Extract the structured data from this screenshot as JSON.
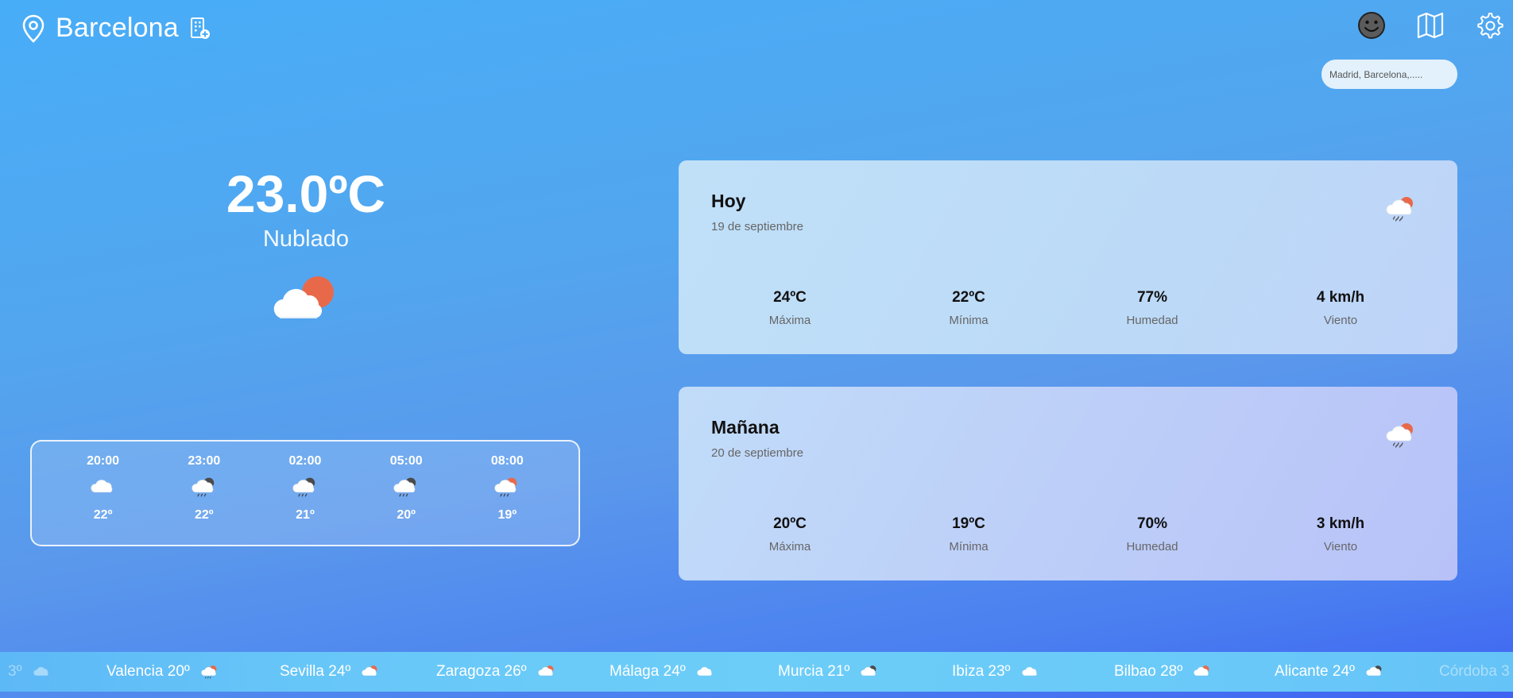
{
  "header": {
    "city": "Barcelona",
    "search_placeholder": "Madrid, Barcelona,....."
  },
  "current": {
    "temperature": "23.0ºC",
    "condition": "Nublado",
    "icon": "cloud-sun-icon"
  },
  "hourly": [
    {
      "time": "20:00",
      "temp": "22º",
      "icon": "cloud-icon"
    },
    {
      "time": "23:00",
      "temp": "22º",
      "icon": "cloud-moon-rain-icon"
    },
    {
      "time": "02:00",
      "temp": "21º",
      "icon": "cloud-moon-rain-icon"
    },
    {
      "time": "05:00",
      "temp": "20º",
      "icon": "cloud-moon-rain-icon"
    },
    {
      "time": "08:00",
      "temp": "19º",
      "icon": "cloud-sun-rain-icon"
    }
  ],
  "forecast": {
    "today": {
      "title": "Hoy",
      "date": "19 de septiembre",
      "icon": "cloud-sun-rain-icon",
      "max": "24ºC",
      "max_label": "Máxima",
      "min": "22ºC",
      "min_label": "Mínima",
      "humidity": "77%",
      "humidity_label": "Humedad",
      "wind": "4 km/h",
      "wind_label": "Viento"
    },
    "tomorrow": {
      "title": "Mañana",
      "date": "20 de septiembre",
      "icon": "cloud-sun-rain-icon",
      "max": "20ºC",
      "max_label": "Máxima",
      "min": "19ºC",
      "min_label": "Mínima",
      "humidity": "70%",
      "humidity_label": "Humedad",
      "wind": "3 km/h",
      "wind_label": "Viento"
    }
  },
  "ticker": [
    {
      "text": "3º",
      "icon": "cloud-icon"
    },
    {
      "text": "Valencia 20º",
      "icon": "cloud-sun-rain-icon"
    },
    {
      "text": "Sevilla 24º",
      "icon": "cloud-sun-icon"
    },
    {
      "text": "Zaragoza 26º",
      "icon": "cloud-sun-icon"
    },
    {
      "text": "Málaga 24º",
      "icon": "cloud-icon"
    },
    {
      "text": "Murcia 21º",
      "icon": "cloud-moon-icon"
    },
    {
      "text": "Ibiza 23º",
      "icon": "cloud-icon"
    },
    {
      "text": "Bilbao 28º",
      "icon": "cloud-sun-icon"
    },
    {
      "text": "Alicante 24º",
      "icon": "cloud-moon-icon"
    },
    {
      "text": "Córdoba 3",
      "icon": ""
    }
  ],
  "colors": {
    "sun": "#e8694a",
    "moon": "#4a4a4a",
    "cloud": "#ffffff"
  }
}
